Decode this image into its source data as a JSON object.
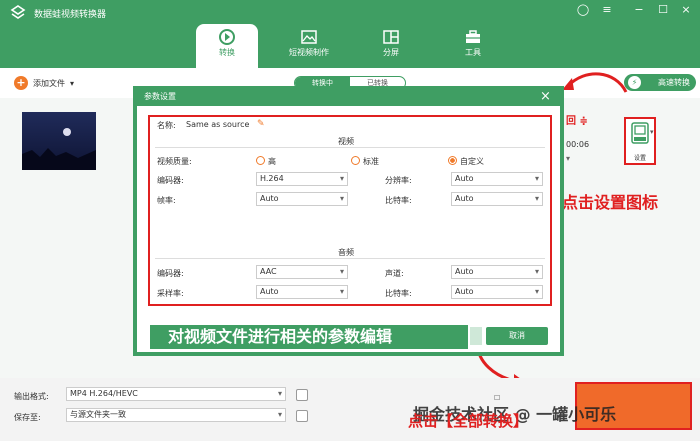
{
  "app": {
    "title": "数据蛙视频转换器"
  },
  "nav": {
    "tabs": [
      {
        "label": "转换"
      },
      {
        "label": "短视频制作"
      },
      {
        "label": "分屏"
      },
      {
        "label": "工具"
      }
    ]
  },
  "toolbar": {
    "add_file": "添加文件",
    "status_tabs": [
      "转换中",
      "已转换"
    ],
    "fast_convert": "高速转换"
  },
  "file": {
    "duration": "00:06",
    "settings_label": "设置"
  },
  "dialog": {
    "title": "参数设置",
    "name_label": "名称:",
    "name_value": "Same as source",
    "video": {
      "heading": "视频",
      "quality_label": "视频质量:",
      "quality_options": [
        "高",
        "标准",
        "自定义"
      ],
      "quality_selected": "自定义",
      "encoder_label": "编码器:",
      "encoder_value": "H.264",
      "resolution_label": "分辨率:",
      "resolution_value": "Auto",
      "framerate_label": "帧率:",
      "framerate_value": "Auto",
      "bitrate_label": "比特率:",
      "bitrate_value": "Auto"
    },
    "audio": {
      "heading": "音频",
      "encoder_label": "编码器:",
      "encoder_value": "AAC",
      "channel_label": "声道:",
      "channel_value": "Auto",
      "samplerate_label": "采样率:",
      "samplerate_value": "Auto",
      "bitrate_label": "比特率:",
      "bitrate_value": "Auto"
    },
    "cancel_label": "取消"
  },
  "bottom": {
    "output_label": "输出格式:",
    "output_value": "MP4 H.264/HEVC",
    "save_label": "保存至:",
    "save_value": "与源文件夹一致"
  },
  "annotations": {
    "right": "点击设置图标",
    "center": "对视频文件进行相关的参数编辑",
    "bottom": "点击【全部转换】"
  },
  "watermark": "掘金技术社区 @ 一罐小可乐",
  "colors": {
    "primary": "#3f9e63",
    "accent": "#f07a2a",
    "annotation": "#e02020"
  }
}
